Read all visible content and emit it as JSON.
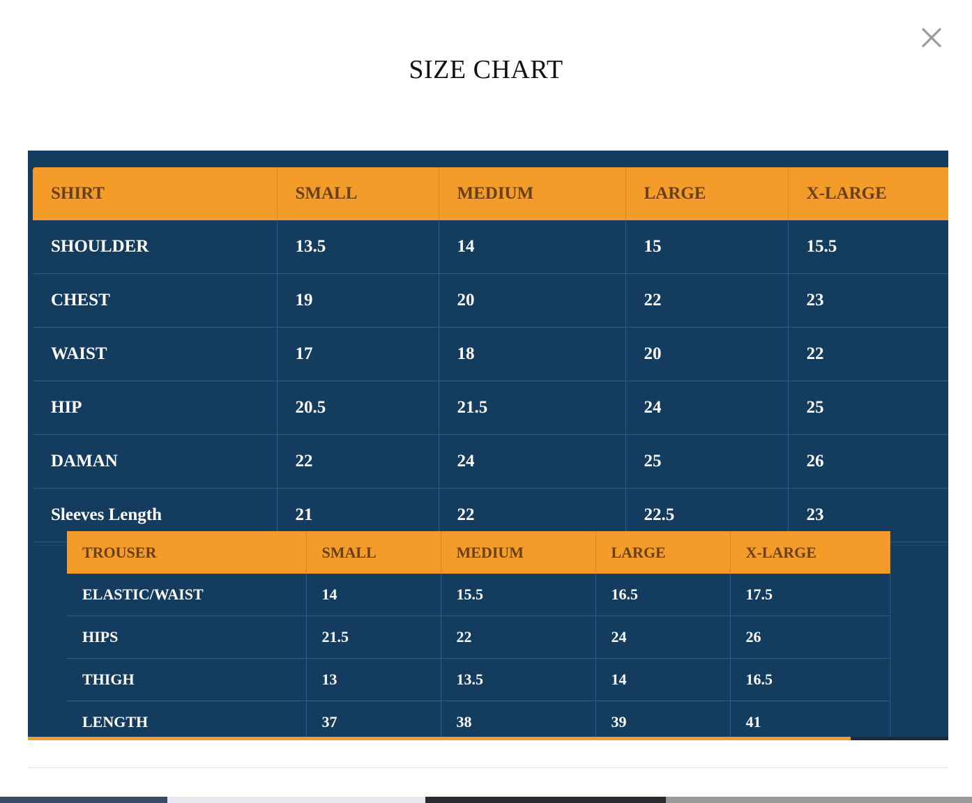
{
  "modal": {
    "title": "SIZE CHART",
    "close_icon": "close-icon"
  },
  "shirt_table": {
    "headers": [
      "SHIRT",
      "SMALL",
      "MEDIUM",
      "LARGE",
      "X-LARGE"
    ],
    "rows": [
      [
        "SHOULDER",
        "13.5",
        "14",
        "15",
        "15.5"
      ],
      [
        "CHEST",
        "19",
        "20",
        "22",
        "23"
      ],
      [
        "WAIST",
        "17",
        "18",
        "20",
        "22"
      ],
      [
        "HIP",
        "20.5",
        "21.5",
        "24",
        "25"
      ],
      [
        "DAMAN",
        "22",
        "24",
        "25",
        "26"
      ],
      [
        "Sleeves Length",
        "21",
        "22",
        "22.5",
        "23"
      ]
    ]
  },
  "trouser_table": {
    "headers": [
      "TROUSER",
      "SMALL",
      "MEDIUM",
      "LARGE",
      "X-LARGE"
    ],
    "rows": [
      [
        "ELASTIC/WAIST",
        "14",
        "15.5",
        "16.5",
        "17.5"
      ],
      [
        "HIPS",
        "21.5",
        "22",
        "24",
        "26"
      ],
      [
        "THIGH",
        "13",
        "13.5",
        "14",
        "16.5"
      ],
      [
        "LENGTH",
        "37",
        "38",
        "39",
        "41"
      ]
    ]
  },
  "colors": {
    "header_orange": "#f39c2a",
    "table_navy": "#133c5e",
    "header_text": "#6b3f16"
  }
}
